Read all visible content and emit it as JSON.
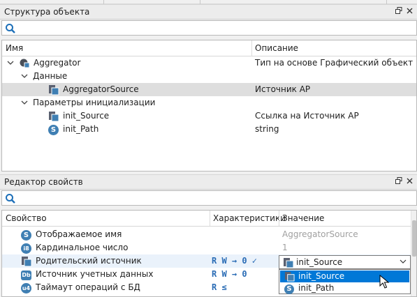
{
  "structure_panel": {
    "title": "Структура объекта",
    "search_placeholder": "",
    "columns": {
      "name": "Имя",
      "description": "Описание"
    },
    "rows": [
      {
        "name": "Aggregator",
        "description": "Тип на основе Графический объект",
        "icon": "object-icon",
        "arrow": "chevron-down-icon"
      },
      {
        "name": "Данные",
        "description": "",
        "icon": "",
        "arrow": "chevron-down-icon"
      },
      {
        "name": "AggregatorSource",
        "description": "Источник АР",
        "icon": "source-icon",
        "arrow": "",
        "selected": true
      },
      {
        "name": "Параметры инициализации",
        "description": "",
        "icon": "",
        "arrow": "chevron-down-icon"
      },
      {
        "name": "init_Source",
        "description": "Ссылка на Источник АР",
        "icon": "source-icon",
        "arrow": ""
      },
      {
        "name": "init_Path",
        "description": "string",
        "icon": "string-icon",
        "arrow": ""
      }
    ]
  },
  "props_panel": {
    "title": "Редактор свойств",
    "search_placeholder": "",
    "columns": {
      "property": "Свойство",
      "characteristics": "Характеристики",
      "value": "Значение"
    },
    "rows": [
      {
        "badge": "S",
        "name": "Отображаемое имя",
        "characteristics": "",
        "value": "AggregatorSource"
      },
      {
        "badge": "i8",
        "name": "Кардинальное число",
        "characteristics": "",
        "value": "1"
      },
      {
        "badge": "",
        "name": "Родительский источник",
        "characteristics": "R W → 0 ✓",
        "value": ""
      },
      {
        "badge": "DB",
        "name": "Источник учетных данных",
        "characteristics": "R W → 0",
        "value": ""
      },
      {
        "badge": "u4",
        "name": "Таймаут операций с БД",
        "characteristics": "R ≤",
        "value": ""
      }
    ]
  },
  "combo": {
    "selected": "init_Source",
    "options": [
      "init_Source",
      "init_Path"
    ]
  },
  "colors": {
    "accent": "#0078d7",
    "badge": "#3f7fb3",
    "rw": "#2a6cb5",
    "selected_row": "#dedede"
  }
}
